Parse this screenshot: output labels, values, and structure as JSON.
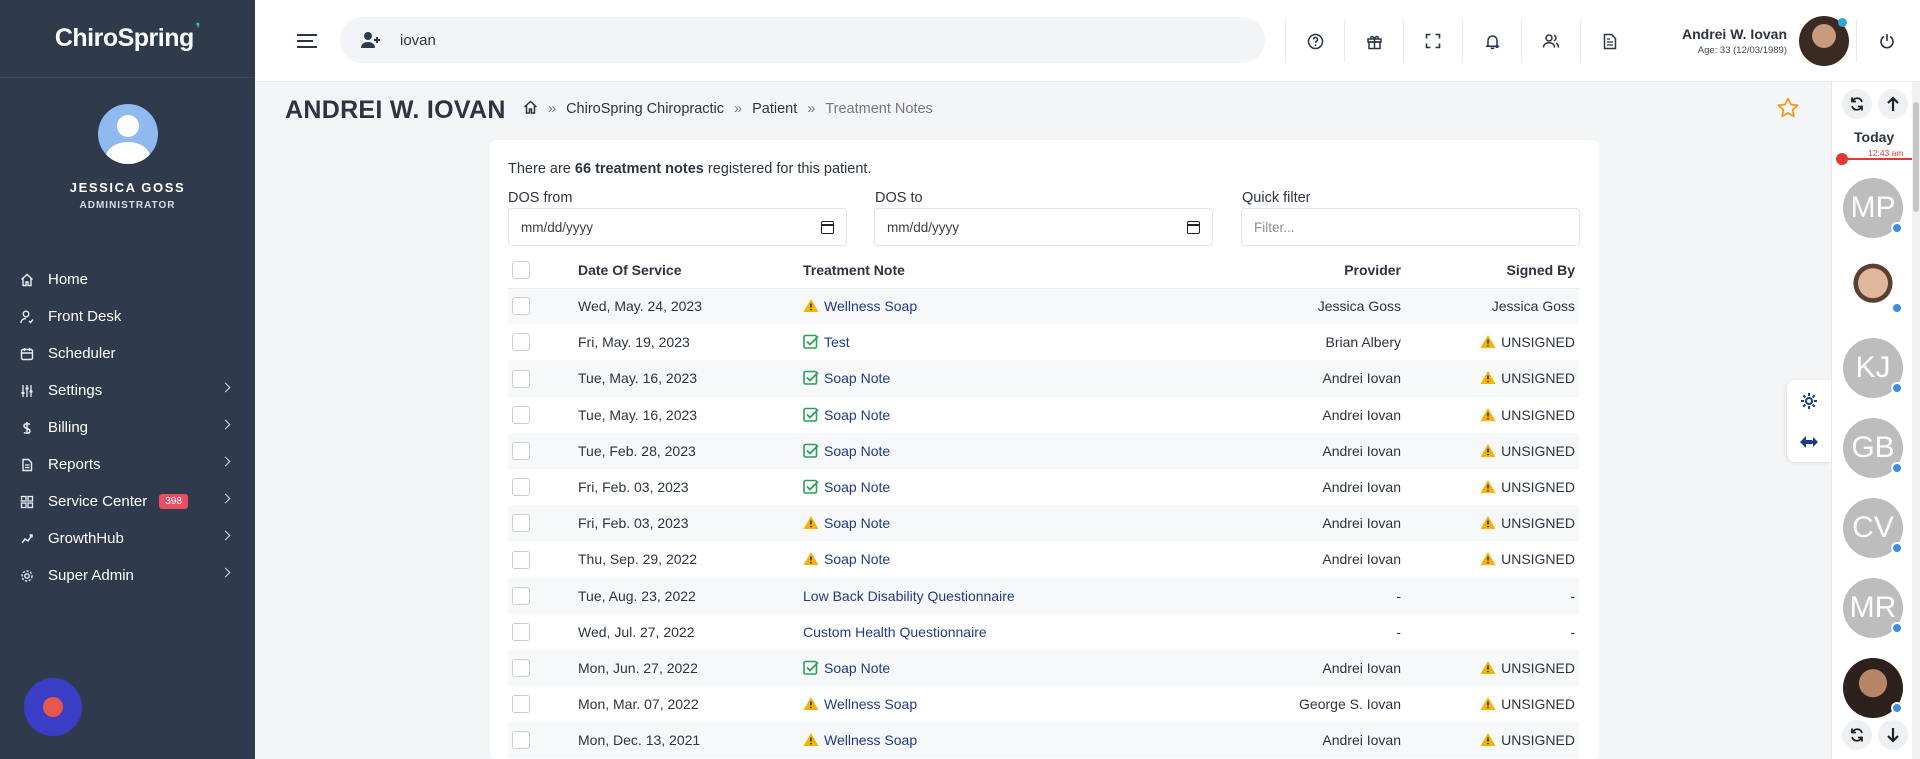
{
  "app": {
    "logo_text": "ChiroSpring"
  },
  "sidebar": {
    "user_name": "JESSICA GOSS",
    "user_role": "ADMINISTRATOR",
    "items": [
      {
        "label": "Home",
        "icon": "home-icon",
        "has_chevron": false
      },
      {
        "label": "Front Desk",
        "icon": "front-desk-icon",
        "has_chevron": false
      },
      {
        "label": "Scheduler",
        "icon": "calendar-icon",
        "has_chevron": false
      },
      {
        "label": "Settings",
        "icon": "sliders-icon",
        "has_chevron": true
      },
      {
        "label": "Billing",
        "icon": "dollar-icon",
        "has_chevron": true
      },
      {
        "label": "Reports",
        "icon": "report-icon",
        "has_chevron": true
      },
      {
        "label": "Service Center",
        "icon": "grid-icon",
        "has_chevron": true,
        "badge": "398"
      },
      {
        "label": "GrowthHub",
        "icon": "growth-icon",
        "has_chevron": true
      },
      {
        "label": "Super Admin",
        "icon": "gear-icon",
        "has_chevron": true
      }
    ]
  },
  "topbar": {
    "search_value": "iovan",
    "icons": [
      "help-icon",
      "gift-icon",
      "fullscreen-icon",
      "bell-icon",
      "users-icon",
      "document-icon"
    ],
    "patient_name": "Andrei W. Iovan",
    "patient_age": "Age: 33 (12/03/1989)"
  },
  "page": {
    "title": "ANDREI W. IOVAN",
    "breadcrumbs": [
      "ChiroSpring Chiropractic",
      "Patient",
      "Treatment Notes"
    ],
    "separator": "»"
  },
  "summary": {
    "prefix": "There are ",
    "count_text": "66 treatment notes",
    "suffix": " registered for this patient."
  },
  "filters": {
    "dos_from_label": "DOS from",
    "dos_from_value": "mm/dd/yyyy",
    "dos_to_label": "DOS to",
    "dos_to_value": "mm/dd/yyyy",
    "quick_filter_label": "Quick filter",
    "quick_filter_placeholder": "Filter..."
  },
  "table": {
    "columns": [
      "Date Of Service",
      "Treatment Note",
      "Provider",
      "Signed By"
    ],
    "rows": [
      {
        "date": "Wed, May. 24, 2023",
        "note": "Wellness Soap",
        "note_status": "warn",
        "provider": "Jessica Goss",
        "signed": "Jessica Goss",
        "signed_status": "none"
      },
      {
        "date": "Fri, May. 19, 2023",
        "note": "Test",
        "note_status": "ok",
        "provider": "Brian Albery",
        "signed": "UNSIGNED",
        "signed_status": "warn"
      },
      {
        "date": "Tue, May. 16, 2023",
        "note": "Soap Note",
        "note_status": "ok",
        "provider": "Andrei Iovan",
        "signed": "UNSIGNED",
        "signed_status": "warn"
      },
      {
        "date": "Tue, May. 16, 2023",
        "note": "Soap Note",
        "note_status": "ok",
        "provider": "Andrei Iovan",
        "signed": "UNSIGNED",
        "signed_status": "warn"
      },
      {
        "date": "Tue, Feb. 28, 2023",
        "note": "Soap Note",
        "note_status": "ok",
        "provider": "Andrei Iovan",
        "signed": "UNSIGNED",
        "signed_status": "warn"
      },
      {
        "date": "Fri, Feb. 03, 2023",
        "note": "Soap Note",
        "note_status": "ok",
        "provider": "Andrei Iovan",
        "signed": "UNSIGNED",
        "signed_status": "warn"
      },
      {
        "date": "Fri, Feb. 03, 2023",
        "note": "Soap Note",
        "note_status": "warn",
        "provider": "Andrei Iovan",
        "signed": "UNSIGNED",
        "signed_status": "warn"
      },
      {
        "date": "Thu, Sep. 29, 2022",
        "note": "Soap Note",
        "note_status": "warn",
        "provider": "Andrei Iovan",
        "signed": "UNSIGNED",
        "signed_status": "warn"
      },
      {
        "date": "Tue, Aug. 23, 2022",
        "note": "Low Back Disability Questionnaire",
        "note_status": "none",
        "provider": "-",
        "signed": "-",
        "signed_status": "none"
      },
      {
        "date": "Wed, Jul. 27, 2022",
        "note": "Custom Health Questionnaire",
        "note_status": "none",
        "provider": "-",
        "signed": "-",
        "signed_status": "none"
      },
      {
        "date": "Mon, Jun. 27, 2022",
        "note": "Soap Note",
        "note_status": "ok",
        "provider": "Andrei Iovan",
        "signed": "UNSIGNED",
        "signed_status": "warn"
      },
      {
        "date": "Mon, Mar. 07, 2022",
        "note": "Wellness Soap",
        "note_status": "warn",
        "provider": "George S. Iovan",
        "signed": "UNSIGNED",
        "signed_status": "warn"
      },
      {
        "date": "Mon, Dec. 13, 2021",
        "note": "Wellness Soap",
        "note_status": "warn",
        "provider": "Andrei Iovan",
        "signed": "UNSIGNED",
        "signed_status": "warn"
      }
    ]
  },
  "rail": {
    "today_label": "Today",
    "time": "12:43 am",
    "avatars": [
      {
        "initials": "MP",
        "kind": "initials"
      },
      {
        "initials": "",
        "kind": "photo1"
      },
      {
        "initials": "KJ",
        "kind": "initials"
      },
      {
        "initials": "GB",
        "kind": "initials"
      },
      {
        "initials": "CV",
        "kind": "initials"
      },
      {
        "initials": "MR",
        "kind": "initials"
      },
      {
        "initials": "",
        "kind": "photo2"
      }
    ]
  },
  "colors": {
    "sidebar": "#2f3b4d",
    "accent": "#3b3fc8",
    "warn": "#f4b400",
    "ok": "#2e9e5b",
    "badge": "#e94e62"
  }
}
